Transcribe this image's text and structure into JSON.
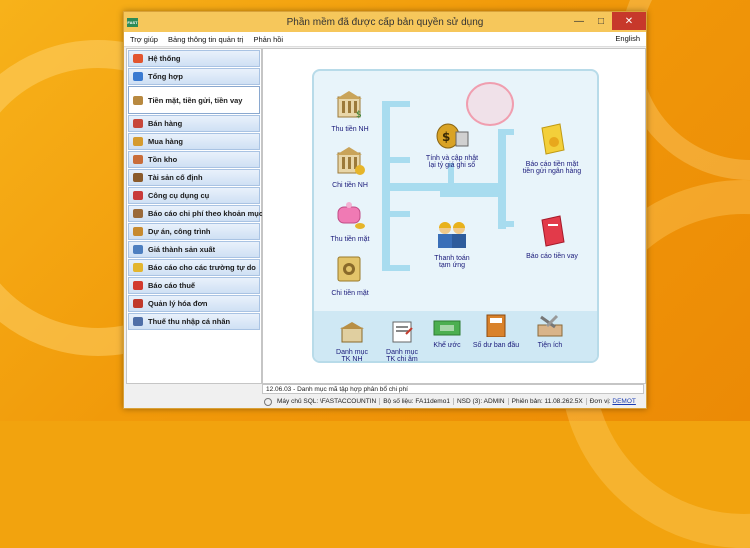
{
  "window": {
    "title": "Phần mềm đã được cấp bản quyền sử dụng",
    "logo_text": "FAST"
  },
  "menu": {
    "items": [
      "Trợ giúp",
      "Bảng thông tin quản trị",
      "Phản hồi"
    ],
    "language": "English"
  },
  "sidebar": {
    "items": [
      {
        "label": "Hệ thống",
        "icon": "system-icon",
        "color": "#e2552f"
      },
      {
        "label": "Tổng hợp",
        "icon": "summary-icon",
        "color": "#3a7ad1"
      },
      {
        "label": "Tiền mặt, tiền gửi, tiền vay",
        "icon": "bank-icon",
        "color": "#b88940",
        "active": true
      },
      {
        "label": "Bán hàng",
        "icon": "sales-icon",
        "color": "#c7473a"
      },
      {
        "label": "Mua hàng",
        "icon": "purchase-icon",
        "color": "#d59b2f"
      },
      {
        "label": "Tồn kho",
        "icon": "inventory-icon",
        "color": "#c96d3a"
      },
      {
        "label": "Tài sản cố định",
        "icon": "asset-icon",
        "color": "#8a5a2b"
      },
      {
        "label": "Công cụ dụng cụ",
        "icon": "tools-icon",
        "color": "#c83a3a"
      },
      {
        "label": "Báo cáo chi phí theo khoản mục",
        "icon": "cost-report-icon",
        "color": "#9a6a3a"
      },
      {
        "label": "Dự án, công trình",
        "icon": "project-icon",
        "color": "#c78a2f"
      },
      {
        "label": "Giá thành sản xuất",
        "icon": "production-cost-icon",
        "color": "#4d7fc0"
      },
      {
        "label": "Báo cáo cho các trường tự do",
        "icon": "custom-report-icon",
        "color": "#e3b52e"
      },
      {
        "label": "Báo cáo thuế",
        "icon": "tax-report-icon",
        "color": "#d23a2f"
      },
      {
        "label": "Quản lý hóa đơn",
        "icon": "invoice-icon",
        "color": "#c0392b"
      },
      {
        "label": "Thuế thu nhập cá nhân",
        "icon": "personal-tax-icon",
        "color": "#4f6fa8"
      }
    ]
  },
  "flow": {
    "left": [
      {
        "label": "Thu tiền NH",
        "icon": "bank-receipt-icon"
      },
      {
        "label": "Chi tiền NH",
        "icon": "bank-payment-icon"
      },
      {
        "label": "Thu tiền mặt",
        "icon": "cash-receipt-icon"
      },
      {
        "label": "Chi tiền mặt",
        "icon": "cash-payment-icon"
      }
    ],
    "center": [
      {
        "label": "Tính và cập nhật\nlại tỷ giá ghi sổ",
        "icon": "exchange-rate-icon"
      },
      {
        "label": "Thanh toán\ntạm ứng",
        "icon": "advance-payment-icon"
      }
    ],
    "right": [
      {
        "label": "Báo cáo tiền mặt\ntiền gửi ngân hàng",
        "icon": "cash-bank-report-icon"
      },
      {
        "label": "Báo cáo tiền vay",
        "icon": "loan-report-icon"
      }
    ],
    "bottom": [
      {
        "label": "Danh mục\nTK NH",
        "icon": "bank-account-list-icon"
      },
      {
        "label": "Danh mục\nTK chi âm",
        "icon": "negative-account-list-icon"
      },
      {
        "label": "Khế ước",
        "icon": "contract-icon"
      },
      {
        "label": "Số dư ban đầu",
        "icon": "opening-balance-icon"
      },
      {
        "label": "Tiện ích",
        "icon": "utilities-icon"
      }
    ]
  },
  "log": {
    "text": "12.06.03 - Danh mục mã tập hợp phân bổ chi phí"
  },
  "status": {
    "server": "Máy chủ SQL: \\FASTACCOUNTIN",
    "dataset": "Bộ số liệu: FA11demo1",
    "user": "NSD (3): ADMIN",
    "version": "Phiên bản: 11.08.262.5X",
    "unit_label": "Đơn vị:",
    "unit_value": "DEMOT"
  }
}
